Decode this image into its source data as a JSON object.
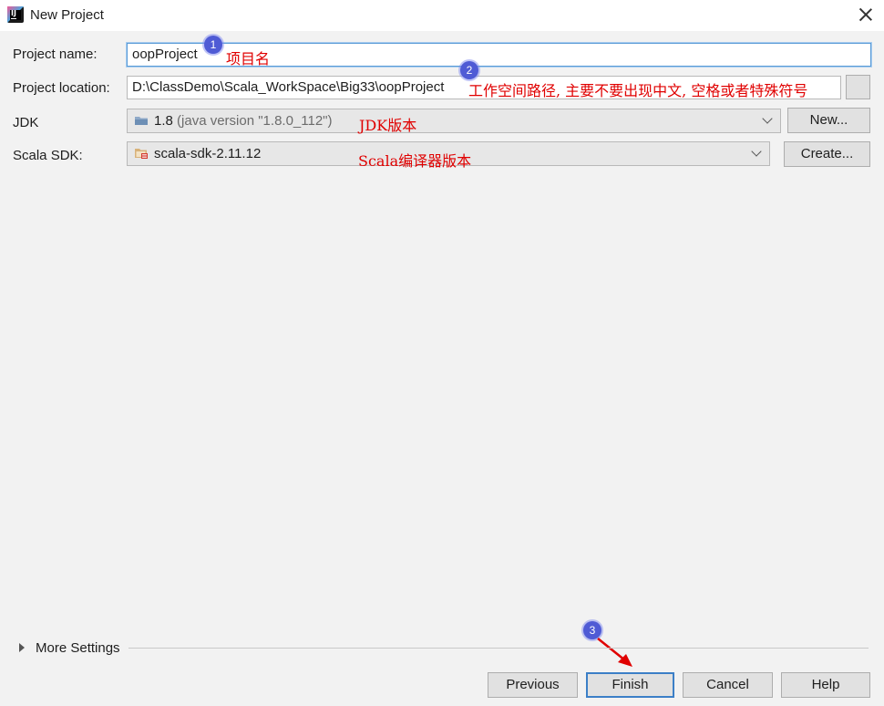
{
  "window": {
    "title": "New Project"
  },
  "form": {
    "project_name_label": "Project name:",
    "project_name_value": "oopProject",
    "project_location_label": "Project location:",
    "project_location_value": "D:\\ClassDemo\\Scala_WorkSpace\\Big33\\oopProject",
    "jdk_label": "JDK",
    "jdk_version": "1.8",
    "jdk_detail": "(java version \"1.8.0_112\")",
    "jdk_new_label": "New...",
    "scala_label": "Scala SDK:",
    "scala_value": "scala-sdk-2.11.12",
    "scala_create_label": "Create..."
  },
  "annotations": {
    "badge1": "1",
    "note1": "项目名",
    "badge2": "2",
    "note2": "工作空间路径, 主要不要出现中文, 空格或者特殊符号",
    "note_jdk": "JDK版本",
    "note_scala": "Scala编译器版本",
    "badge3": "3"
  },
  "more_settings": {
    "label": "More Settings"
  },
  "footer": {
    "previous": "Previous",
    "finish": "Finish",
    "cancel": "Cancel",
    "help": "Help"
  },
  "colors": {
    "annotation": "#e00000",
    "badge": "#4f5bd5",
    "focus": "#5a9bd6"
  },
  "icons": [
    "intellij-icon",
    "close-icon",
    "folder-icon",
    "library-icon",
    "chevron-down-icon",
    "triangle-right-icon",
    "red-arrow"
  ]
}
